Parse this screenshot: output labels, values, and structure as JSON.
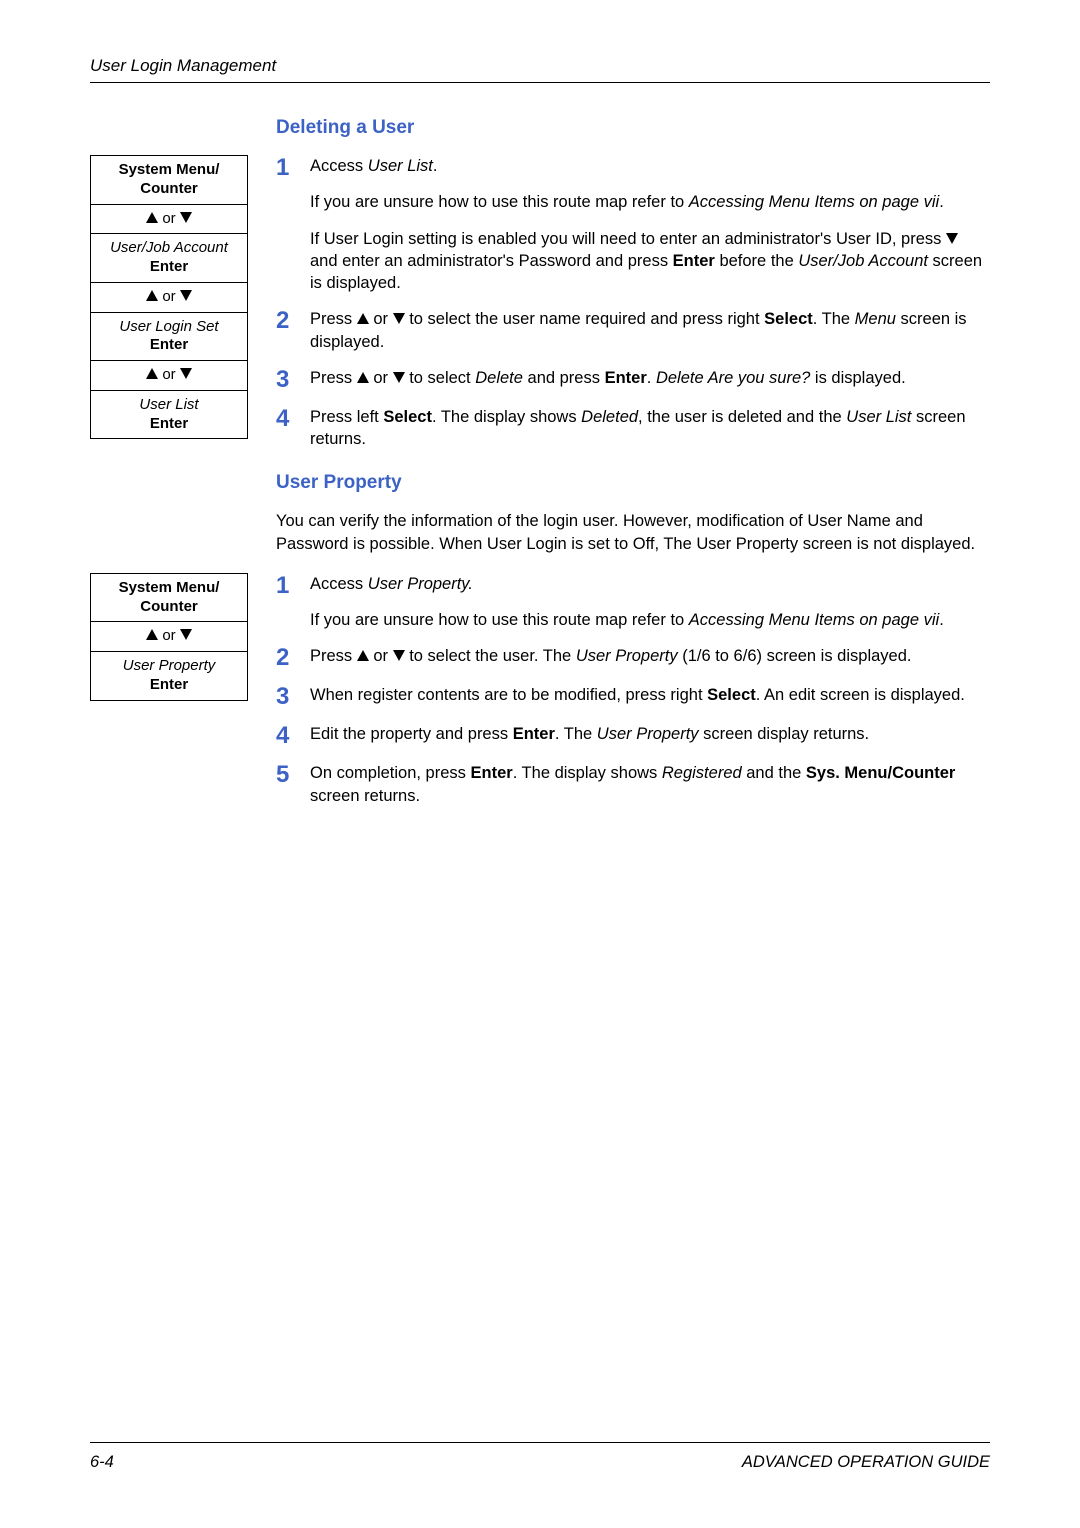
{
  "header": {
    "running_head": "User Login Management"
  },
  "section1": {
    "title": "Deleting a User",
    "route": {
      "r1_l1": "System Menu/",
      "r1_l2": "Counter",
      "or": " or ",
      "r3_l1": "User/Job Account",
      "r3_l2": "Enter",
      "r5_l1": "User Login Set",
      "r5_l2": "Enter",
      "r7_l1": "User List",
      "r7_l2": "Enter"
    },
    "steps": {
      "s1": {
        "p1_a": "Access ",
        "p1_b": "User List",
        "p1_c": ".",
        "p2_a": "If you are unsure how to use this route map refer to ",
        "p2_b": "Accessing Menu Items on page vii",
        "p2_c": ".",
        "p3_a": "If User Login setting is enabled you will need to enter an administrator's User ID, press ",
        "p3_b": " and enter an administrator's Password and press ",
        "p3_c": "Enter",
        "p3_d": " before the ",
        "p3_e": "User/Job Account",
        "p3_f": " screen is displayed."
      },
      "s2": {
        "a": "Press ",
        "b": " or ",
        "c": " to select the user name required and press right ",
        "d": "Select",
        "e": ". The ",
        "f": "Menu",
        "g": " screen is displayed."
      },
      "s3": {
        "a": "Press ",
        "b": " or ",
        "c": " to select ",
        "d": "Delete",
        "e": " and press ",
        "f": "Enter",
        "g": ". ",
        "h": "Delete Are you sure?",
        "i": " is displayed."
      },
      "s4": {
        "a": "Press left ",
        "b": "Select",
        "c": ". The display shows ",
        "d": "Deleted",
        "e": ", the user is deleted and the ",
        "f": "User List",
        "g": " screen returns."
      }
    }
  },
  "section2": {
    "title": "User Property",
    "intro": "You can verify the information of the login user. However, modification of User Name and Password is possible. When User Login is set to Off, The User Property screen is not displayed.",
    "route": {
      "r1_l1": "System Menu/",
      "r1_l2": "Counter",
      "or": " or ",
      "r3_l1": "User Property",
      "r3_l2": "Enter"
    },
    "steps": {
      "s1": {
        "p1_a": "Access ",
        "p1_b": "User Property.",
        "p2_a": "If you are unsure how to use this route map refer to ",
        "p2_b": "Accessing Menu Items on page vii",
        "p2_c": "."
      },
      "s2": {
        "a": "Press ",
        "b": " or ",
        "c": " to select the user. The ",
        "d": "User Property",
        "e": " (1/6 to 6/6) screen is displayed."
      },
      "s3": {
        "a": "When register contents are to be modified, press right ",
        "b": "Select",
        "c": ". An edit screen is displayed."
      },
      "s4": {
        "a": "Edit the property and press ",
        "b": "Enter",
        "c": ". The ",
        "d": "User Property",
        "e": " screen display returns."
      },
      "s5": {
        "a": "On completion, press ",
        "b": "Enter",
        "c": ". The display shows ",
        "d": "Registered",
        "e": " and the ",
        "f": "Sys. Menu/Counter",
        "g": " screen returns."
      }
    }
  },
  "footer": {
    "page": "6-4",
    "guide": "ADVANCED OPERATION GUIDE"
  },
  "nums": {
    "n1": "1",
    "n2": "2",
    "n3": "3",
    "n4": "4",
    "n5": "5"
  }
}
